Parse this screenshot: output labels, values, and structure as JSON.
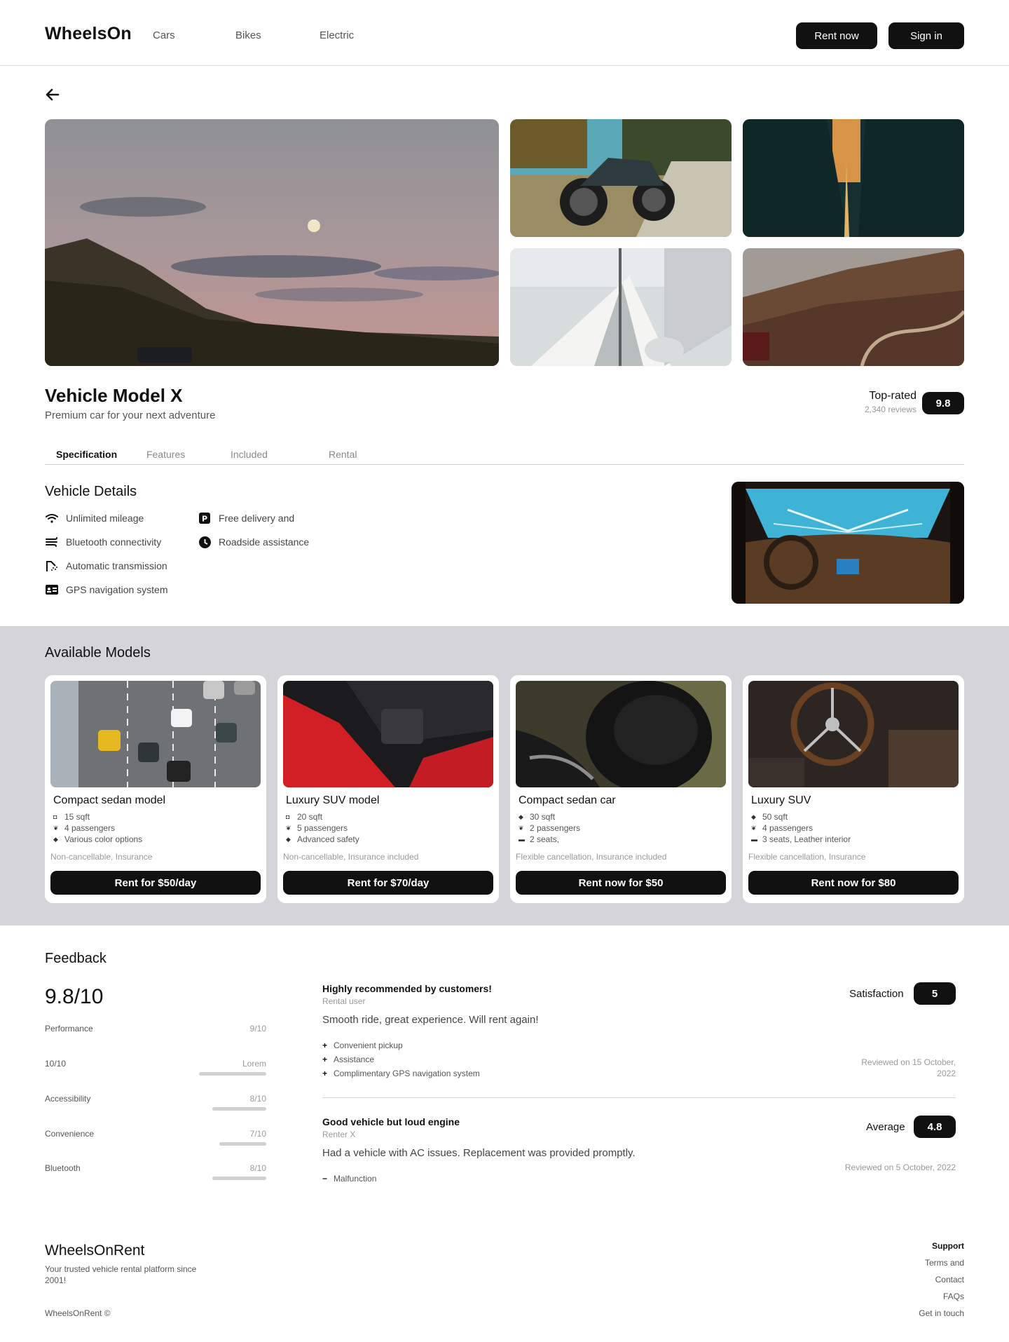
{
  "header": {
    "brand": "WheelsOn",
    "nav": [
      "Cars",
      "Bikes",
      "Electric"
    ],
    "rent_now": "Rent now",
    "sign_in": "Sign in"
  },
  "vehicle": {
    "title": "Vehicle Model X",
    "subtitle": "Premium car for your next adventure",
    "rating_label": "Top-rated",
    "reviews": "2,340 reviews",
    "score": "9.8"
  },
  "tabs": [
    "Specification",
    "Features",
    "Included",
    "Rental"
  ],
  "details": {
    "heading": "Vehicle Details",
    "left": [
      {
        "icon": "wifi-icon",
        "label": "Unlimited mileage"
      },
      {
        "icon": "wind-icon",
        "label": "Bluetooth connectivity"
      },
      {
        "icon": "shower-icon",
        "label": "Automatic transmission"
      },
      {
        "icon": "id-card-icon",
        "label": "GPS navigation system"
      }
    ],
    "right": [
      {
        "icon": "parking-icon",
        "label": "Free delivery and"
      },
      {
        "icon": "clock-icon",
        "label": "Roadside assistance"
      }
    ]
  },
  "models": {
    "heading": "Available Models",
    "cards": [
      {
        "title": "Compact sedan model",
        "specs": [
          "15 sqft",
          "4 passengers",
          "Various color options"
        ],
        "note": "Non-cancellable, Insurance",
        "button": "Rent for $50/day"
      },
      {
        "title": "Luxury SUV model",
        "specs": [
          "20 sqft",
          "5 passengers",
          "Advanced safety"
        ],
        "note": "Non-cancellable, Insurance included",
        "button": "Rent for $70/day"
      },
      {
        "title": "Compact sedan car",
        "specs": [
          "30 sqft",
          "2 passengers",
          "2 seats,"
        ],
        "note": "Flexible cancellation, Insurance included",
        "button": "Rent now for $50"
      },
      {
        "title": "Luxury SUV",
        "specs": [
          "50 sqft",
          "4 passengers",
          "3 seats, Leather interior"
        ],
        "note": "Flexible cancellation, Insurance",
        "button": "Rent now for $80"
      }
    ]
  },
  "feedback": {
    "heading": "Feedback",
    "overall": "9.8/10",
    "metrics": [
      {
        "label": "Performance",
        "value": "9/10",
        "fraction": 0.9
      },
      {
        "label": "10/10",
        "value": "Lorem",
        "fraction": 1.0
      },
      {
        "label": "Accessibility",
        "value": "8/10",
        "fraction": 0.8
      },
      {
        "label": "Convenience",
        "value": "7/10",
        "fraction": 0.7
      },
      {
        "label": "Bluetooth",
        "value": "8/10",
        "fraction": 0.8
      }
    ],
    "reviews": [
      {
        "title": "Highly recommended by customers!",
        "user": "Rental user",
        "body": "Smooth ride, great experience. Will rent again!",
        "points": [
          {
            "sign": "+",
            "text": "Convenient pickup"
          },
          {
            "sign": "+",
            "text": "Assistance"
          },
          {
            "sign": "+",
            "text": "Complimentary GPS navigation system"
          }
        ],
        "label": "Satisfaction",
        "score": "5",
        "date": "Reviewed on 15 October, 2022"
      },
      {
        "title": "Good vehicle but loud engine",
        "user": "Renter X",
        "body": "Had a vehicle with AC issues. Replacement was provided promptly.",
        "points": [
          {
            "sign": "−",
            "text": "Malfunction"
          }
        ],
        "label": "Average",
        "score": "4.8",
        "date": "Reviewed on 5 October, 2022"
      }
    ]
  },
  "footer": {
    "brand": "WheelsOnRent",
    "description": "Your trusted vehicle rental platform since 2001!",
    "copyright": "WheelsOnRent ©",
    "links": [
      "Support",
      "Terms and",
      "Contact",
      "FAQs",
      "Get in touch"
    ]
  }
}
